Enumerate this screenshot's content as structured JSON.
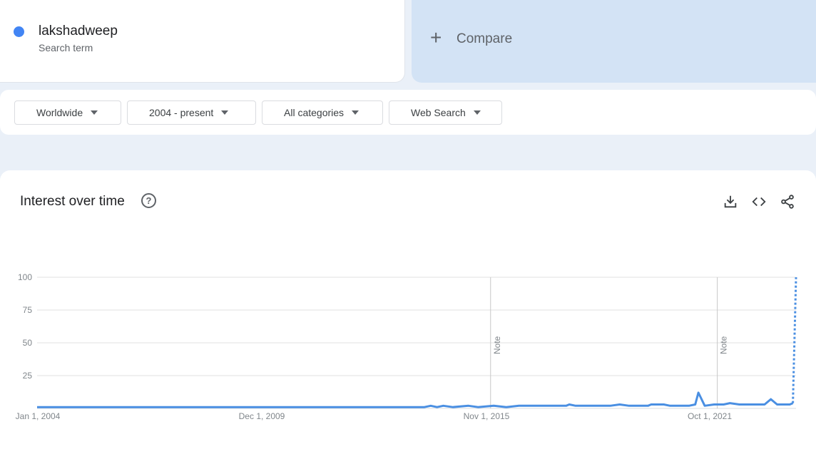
{
  "term": {
    "name": "lakshadweep",
    "subtitle": "Search term",
    "color": "#4285f4"
  },
  "compare": {
    "label": "Compare"
  },
  "filters": [
    {
      "label": "Worldwide"
    },
    {
      "label": "2004 - present"
    },
    {
      "label": "All categories"
    },
    {
      "label": "Web Search"
    }
  ],
  "section": {
    "title": "Interest over time",
    "help_icon": "help-circle-icon",
    "tools": [
      "download-icon",
      "embed-code-icon",
      "share-icon"
    ]
  },
  "chart_data": {
    "type": "line",
    "title": "",
    "xlabel": "",
    "ylabel": "",
    "ylim": [
      0,
      100
    ],
    "y_ticks": [
      100,
      75,
      50,
      25
    ],
    "x_tick_labels": [
      "Jan 1, 2004",
      "Dec 1, 2009",
      "Nov 1, 2015",
      "Oct 1, 2021"
    ],
    "x_range": [
      "2004-01",
      "2024-01"
    ],
    "grid": true,
    "line_color": "#4a8fe2",
    "annotations": [
      {
        "label": "Note",
        "date": "2016-01"
      },
      {
        "label": "Note",
        "date": "2022-01"
      }
    ],
    "series": [
      {
        "points": [
          [
            "2004-01",
            1
          ],
          [
            "2007-03",
            1
          ],
          [
            "2010-01",
            1
          ],
          [
            "2013-01",
            1
          ],
          [
            "2014-04",
            1
          ],
          [
            "2014-06",
            2
          ],
          [
            "2014-08",
            1
          ],
          [
            "2014-10",
            2
          ],
          [
            "2015-01",
            1
          ],
          [
            "2015-06",
            2
          ],
          [
            "2015-09",
            1
          ],
          [
            "2016-02",
            2
          ],
          [
            "2016-06",
            1
          ],
          [
            "2016-10",
            2
          ],
          [
            "2017-06",
            2
          ],
          [
            "2018-01",
            2
          ],
          [
            "2018-02",
            3
          ],
          [
            "2018-04",
            2
          ],
          [
            "2019-03",
            2
          ],
          [
            "2019-06",
            3
          ],
          [
            "2019-09",
            2
          ],
          [
            "2020-03",
            2
          ],
          [
            "2020-04",
            3
          ],
          [
            "2020-08",
            3
          ],
          [
            "2020-10",
            2
          ],
          [
            "2021-04",
            2
          ],
          [
            "2021-06",
            3
          ],
          [
            "2021-07",
            12
          ],
          [
            "2021-09",
            2
          ],
          [
            "2021-12",
            3
          ],
          [
            "2022-03",
            3
          ],
          [
            "2022-05",
            4
          ],
          [
            "2022-08",
            3
          ],
          [
            "2023-04",
            3
          ],
          [
            "2023-06",
            7
          ],
          [
            "2023-08",
            3
          ],
          [
            "2023-12",
            3
          ],
          [
            "2024-01",
            4
          ]
        ],
        "partial_points": [
          [
            "2024-01",
            4
          ],
          [
            "2024-02",
            100
          ]
        ]
      }
    ]
  }
}
